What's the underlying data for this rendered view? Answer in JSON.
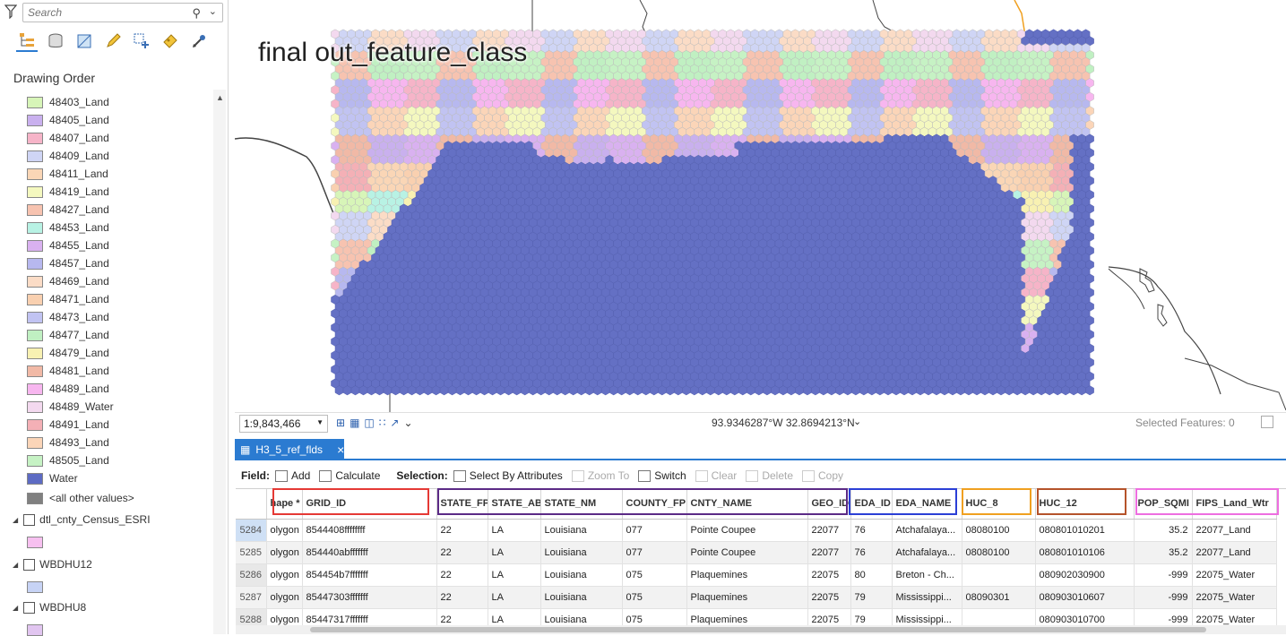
{
  "search": {
    "placeholder": "Search"
  },
  "contents_tools": [
    "list-by-drawing-order-icon",
    "database-icon",
    "source-icon",
    "edit-icon",
    "selection-icon",
    "labeling-icon",
    "snapping-icon"
  ],
  "drawing_order": {
    "title": "Drawing Order"
  },
  "legend": [
    {
      "label": "48403_Land",
      "color": "#d7f5b8"
    },
    {
      "label": "48405_Land",
      "color": "#c9b0ee"
    },
    {
      "label": "48407_Land",
      "color": "#f6b4c8"
    },
    {
      "label": "48409_Land",
      "color": "#cfd5f5"
    },
    {
      "label": "48411_Land",
      "color": "#fad6b6"
    },
    {
      "label": "48419_Land",
      "color": "#f4f8bf"
    },
    {
      "label": "48427_Land",
      "color": "#f7c3b0"
    },
    {
      "label": "48453_Land",
      "color": "#b8f2e4"
    },
    {
      "label": "48455_Land",
      "color": "#d9b1f0"
    },
    {
      "label": "48457_Land",
      "color": "#b7b8ef"
    },
    {
      "label": "48469_Land",
      "color": "#fbdcc6"
    },
    {
      "label": "48471_Land",
      "color": "#f9d0b0"
    },
    {
      "label": "48473_Land",
      "color": "#c1c3f2"
    },
    {
      "label": "48477_Land",
      "color": "#c0f0c2"
    },
    {
      "label": "48479_Land",
      "color": "#f8f1b2"
    },
    {
      "label": "48481_Land",
      "color": "#f1b9a6"
    },
    {
      "label": "48489_Land",
      "color": "#f7b6ef"
    },
    {
      "label": "48489_Water",
      "color": "#f3d9ef"
    },
    {
      "label": "48491_Land",
      "color": "#f4b0b6"
    },
    {
      "label": "48493_Land",
      "color": "#fbd5b8"
    },
    {
      "label": "48505_Land",
      "color": "#c6f2c4"
    },
    {
      "label": "Water",
      "color": "#5d6bc3"
    }
  ],
  "all_other_values": {
    "label": "<all other values>",
    "color": "#808080"
  },
  "layers": [
    {
      "label": "dtl_cnty_Census_ESRI",
      "color": "#f7c0f0"
    },
    {
      "label": "WBDHU12",
      "color": "#c7d3f5"
    },
    {
      "label": "WBDHU8",
      "color": "#e1c5f0"
    }
  ],
  "map": {
    "title": "final out_feature_class",
    "water_color": "#6470c4"
  },
  "map_status": {
    "scale": "1:9,843,466",
    "coordinates": "93.9346287°W 32.8694213°N",
    "selected_features": "Selected Features: 0"
  },
  "table_tab": {
    "label": "H3_5_ref_flds"
  },
  "table_toolbar": {
    "field_label": "Field:",
    "add": "Add",
    "calculate": "Calculate",
    "selection_label": "Selection:",
    "select_by_attributes": "Select By Attributes",
    "zoom_to": "Zoom To",
    "switch": "Switch",
    "clear": "Clear",
    "delete": "Delete",
    "copy": "Copy"
  },
  "table": {
    "columns": [
      "hape *",
      "GRID_ID",
      "STATE_FP",
      "STATE_AB",
      "STATE_NM",
      "COUNTY_FP",
      "CNTY_NAME",
      "GEO_ID",
      "EDA_ID",
      "EDA_NAME",
      "HUC_8",
      "HUC_12",
      "POP_SQMI",
      "FIPS_Land_Wtr"
    ],
    "rows": [
      {
        "n": "5284",
        "cells": [
          "olygon",
          "8544408ffffffff",
          "22",
          "LA",
          "Louisiana",
          "077",
          "Pointe Coupee",
          "22077",
          "76",
          "Atchafalaya...",
          "08080100",
          "080801010201",
          "35.2",
          "22077_Land"
        ]
      },
      {
        "n": "5285",
        "cells": [
          "olygon",
          "854440abfffffff",
          "22",
          "LA",
          "Louisiana",
          "077",
          "Pointe Coupee",
          "22077",
          "76",
          "Atchafalaya...",
          "08080100",
          "080801010106",
          "35.2",
          "22077_Land"
        ]
      },
      {
        "n": "5286",
        "cells": [
          "olygon",
          "854454b7fffffff",
          "22",
          "LA",
          "Louisiana",
          "075",
          "Plaquemines",
          "22075",
          "80",
          "Breton - Ch...",
          "",
          "080902030900",
          "-999",
          "22075_Water"
        ]
      },
      {
        "n": "5287",
        "cells": [
          "olygon",
          "85447303fffffff",
          "22",
          "LA",
          "Louisiana",
          "075",
          "Plaquemines",
          "22075",
          "79",
          "Mississippi...",
          "08090301",
          "080903010607",
          "-999",
          "22075_Water"
        ]
      },
      {
        "n": "5288",
        "cells": [
          "olygon",
          "85447317fffffff",
          "22",
          "LA",
          "Louisiana",
          "075",
          "Plaquemines",
          "22075",
          "79",
          "Mississippi...",
          "",
          "080903010700",
          "-999",
          "22075_Water"
        ]
      }
    ]
  },
  "highlight_colors": {
    "grid": "#e53935",
    "geo": "#5b2a86",
    "eda": "#2b3fd6",
    "huc8": "#f0a020",
    "huc12": "#b5532a",
    "fips": "#ee6ee0"
  }
}
